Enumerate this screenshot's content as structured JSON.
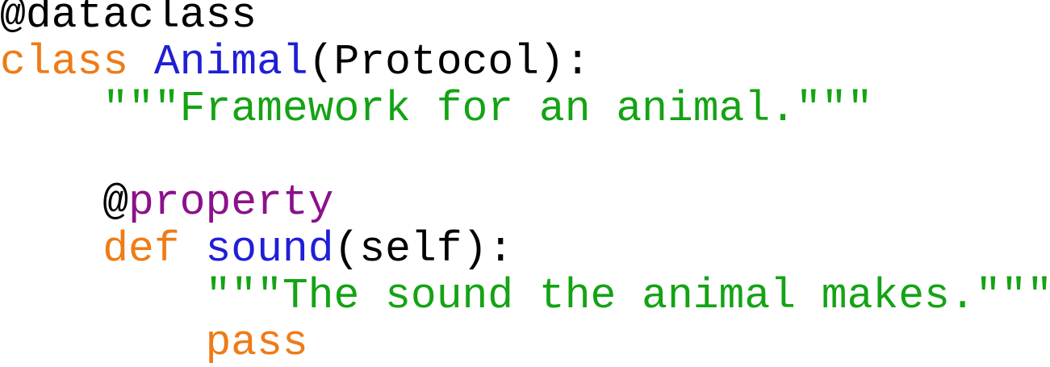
{
  "colors": {
    "keyword": "#ef7b17",
    "name": "#1f1fd6",
    "string": "#14a314",
    "decorator": "#8b128b",
    "plain": "#000000"
  },
  "code": {
    "line1": {
      "at": "@",
      "decorator": "dataclass"
    },
    "line2": {
      "keyword": "class",
      "name": "Animal",
      "rest": "(Protocol):"
    },
    "line3": {
      "indent": "    ",
      "docstring": "\"\"\"Framework for an animal.\"\"\""
    },
    "line4": {},
    "line5": {
      "indent": "    ",
      "at": "@",
      "decorator": "property"
    },
    "line6": {
      "indent": "    ",
      "keyword": "def",
      "name": "sound",
      "rest": "(self):"
    },
    "line7": {
      "indent": "        ",
      "docstring": "\"\"\"The sound the animal makes.\"\"\""
    },
    "line8": {
      "indent": "        ",
      "keyword": "pass"
    }
  }
}
